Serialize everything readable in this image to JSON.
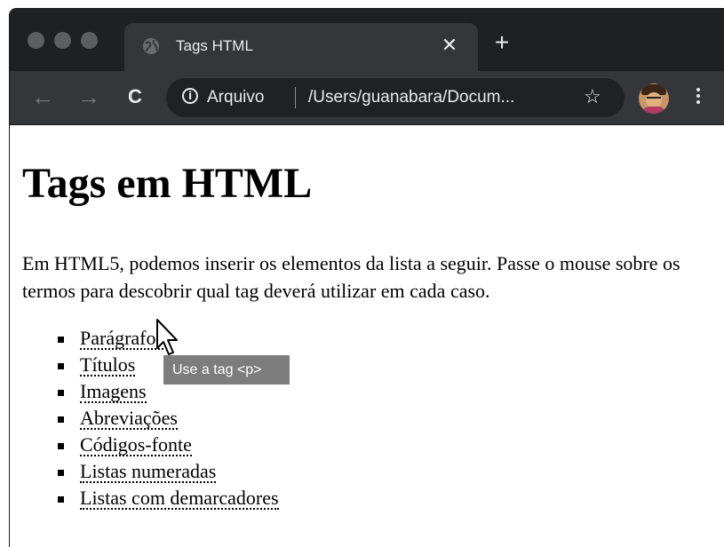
{
  "browser": {
    "tab": {
      "title": "Tags HTML",
      "close_symbol": "✕",
      "favicon": "globe-icon"
    },
    "new_tab_symbol": "+",
    "nav": {
      "back_symbol": "←",
      "forward_symbol": "→",
      "reload_symbol": "C"
    },
    "omnibox": {
      "info_symbol": "i",
      "security_label": "Arquivo",
      "url": "/Users/guanabara/Docum...",
      "bookmark_symbol": "☆"
    },
    "colors": {
      "titlebar": "#1f2023",
      "toolbar": "#35363a",
      "omnibox": "#202124",
      "text": "#e8eaed"
    }
  },
  "page": {
    "heading": "Tags em HTML",
    "intro": "Em HTML5, podemos inserir os elementos da lista a seguir. Passe o mouse sobre os termos para descobrir qual tag deverá utilizar em cada caso.",
    "items": [
      {
        "label": "Parágrafos"
      },
      {
        "label": "Títulos"
      },
      {
        "label": "Imagens"
      },
      {
        "label": "Abreviações"
      },
      {
        "label": "Códigos-fonte"
      },
      {
        "label": "Listas numeradas"
      },
      {
        "label": "Listas com demarcadores"
      }
    ],
    "tooltip": "Use a tag <p>"
  }
}
